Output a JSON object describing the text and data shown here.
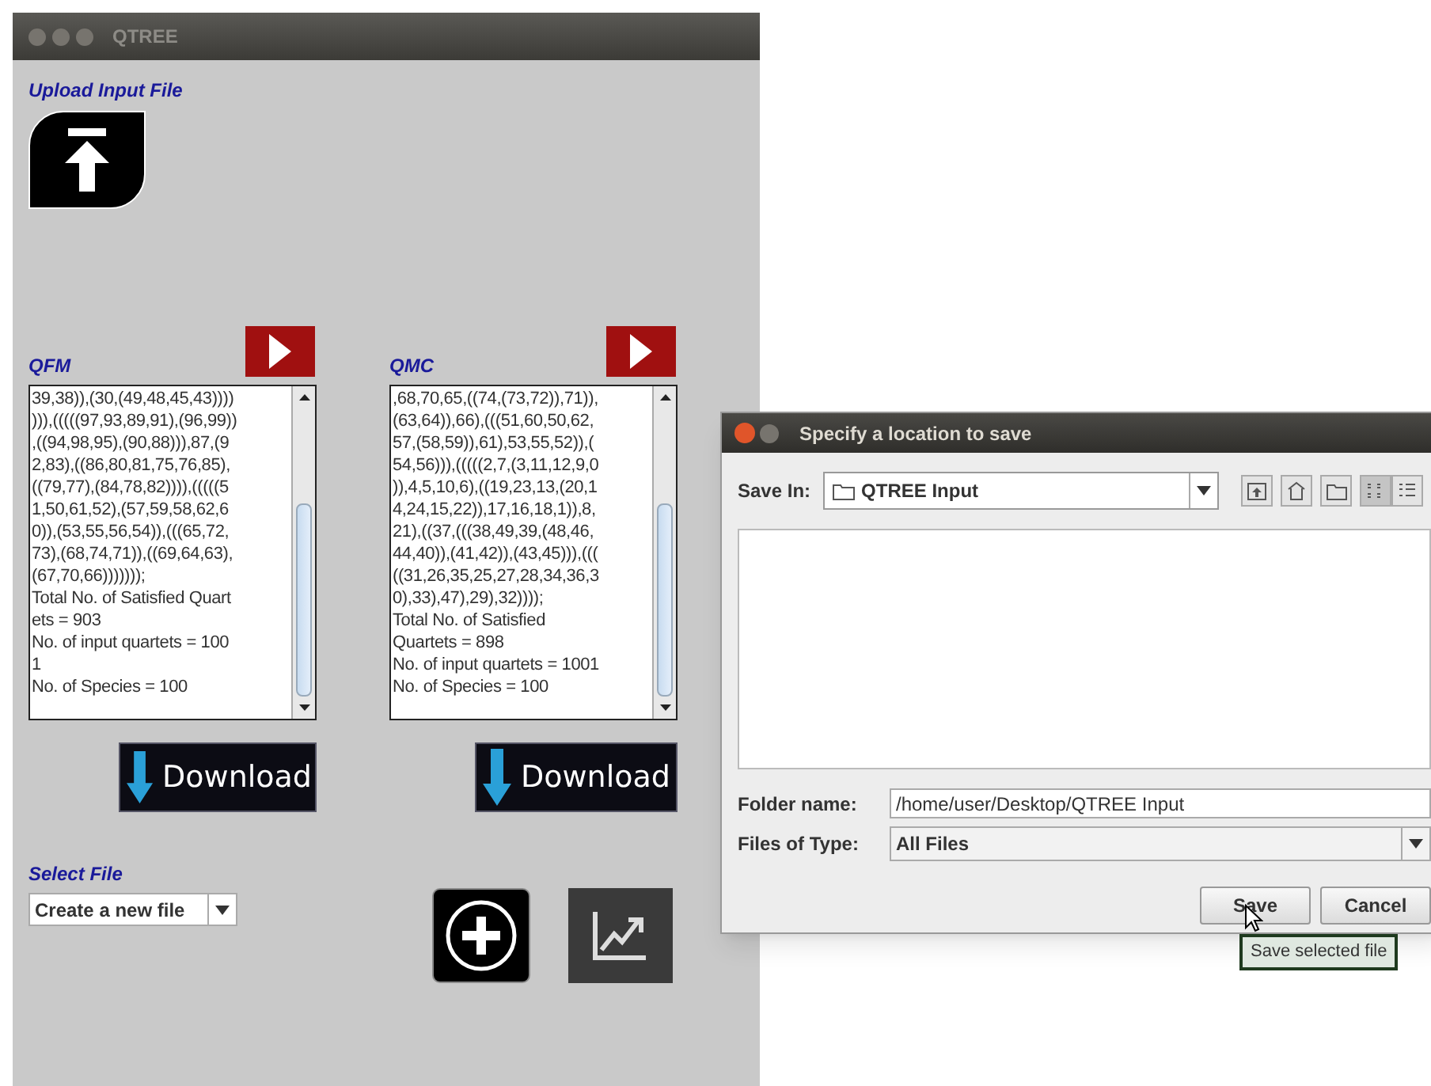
{
  "main_window": {
    "title": "QTREE"
  },
  "upload": {
    "label": "Upload Input File"
  },
  "results": [
    {
      "label": "QFM",
      "lines": [
        "39,38)),(30,(49,48,45,43))))",
        "))),(((((97,93,89,91),(96,99))",
        ",((94,98,95),(90,88))),87,(9",
        "2,83),((86,80,81,75,76,85),",
        "((79,77),(84,78,82)))),(((((5",
        "1,50,61,52),(57,59,58,62,6",
        "0)),(53,55,56,54)),(((65,72,",
        "73),(68,74,71)),((69,64,63),",
        "(67,70,66)))))));",
        "Total No. of Satisfied Quart",
        "ets = 903",
        "No. of input quartets = 100",
        "1",
        "No. of Species = 100"
      ],
      "download": "Download"
    },
    {
      "label": "QMC",
      "lines": [
        ",68,70,65,((74,(73,72)),71)),",
        "(63,64)),66),(((51,60,50,62,",
        "57,(58,59)),61),53,55,52)),(",
        "54,56))),(((((2,7,(3,11,12,9,0",
        ")),4,5,10,6),((19,23,13,(20,1",
        "4,24,15,22)),17,16,18,1)),8,",
        "21),((37,(((38,49,39,(48,46,",
        "44,40)),(41,42)),(43,45))),(((",
        "((31,26,35,25,27,28,34,36,3",
        "0),33),47),29),32))));",
        "Total No. of Satisfied",
        "Quartets = 898",
        "No. of input quartets = 1001",
        "No. of Species = 100"
      ],
      "download": "Download"
    }
  ],
  "select_file": {
    "label": "Select File",
    "value": "Create a new file"
  },
  "save_dialog": {
    "title": "Specify a location to save",
    "save_in_label": "Save In:",
    "save_in_value": "QTREE Input",
    "view_buttons": [
      {
        "kind": "list",
        "selected": true
      },
      {
        "kind": "details",
        "selected": false
      }
    ],
    "folder_name_label": "Folder name:",
    "folder_name_value": "/home/user/Desktop/QTREE Input",
    "files_of_type_label": "Files of Type:",
    "files_of_type_value": "All Files",
    "buttons": [
      "Save",
      "Cancel"
    ],
    "tooltip": "Save selected file"
  }
}
